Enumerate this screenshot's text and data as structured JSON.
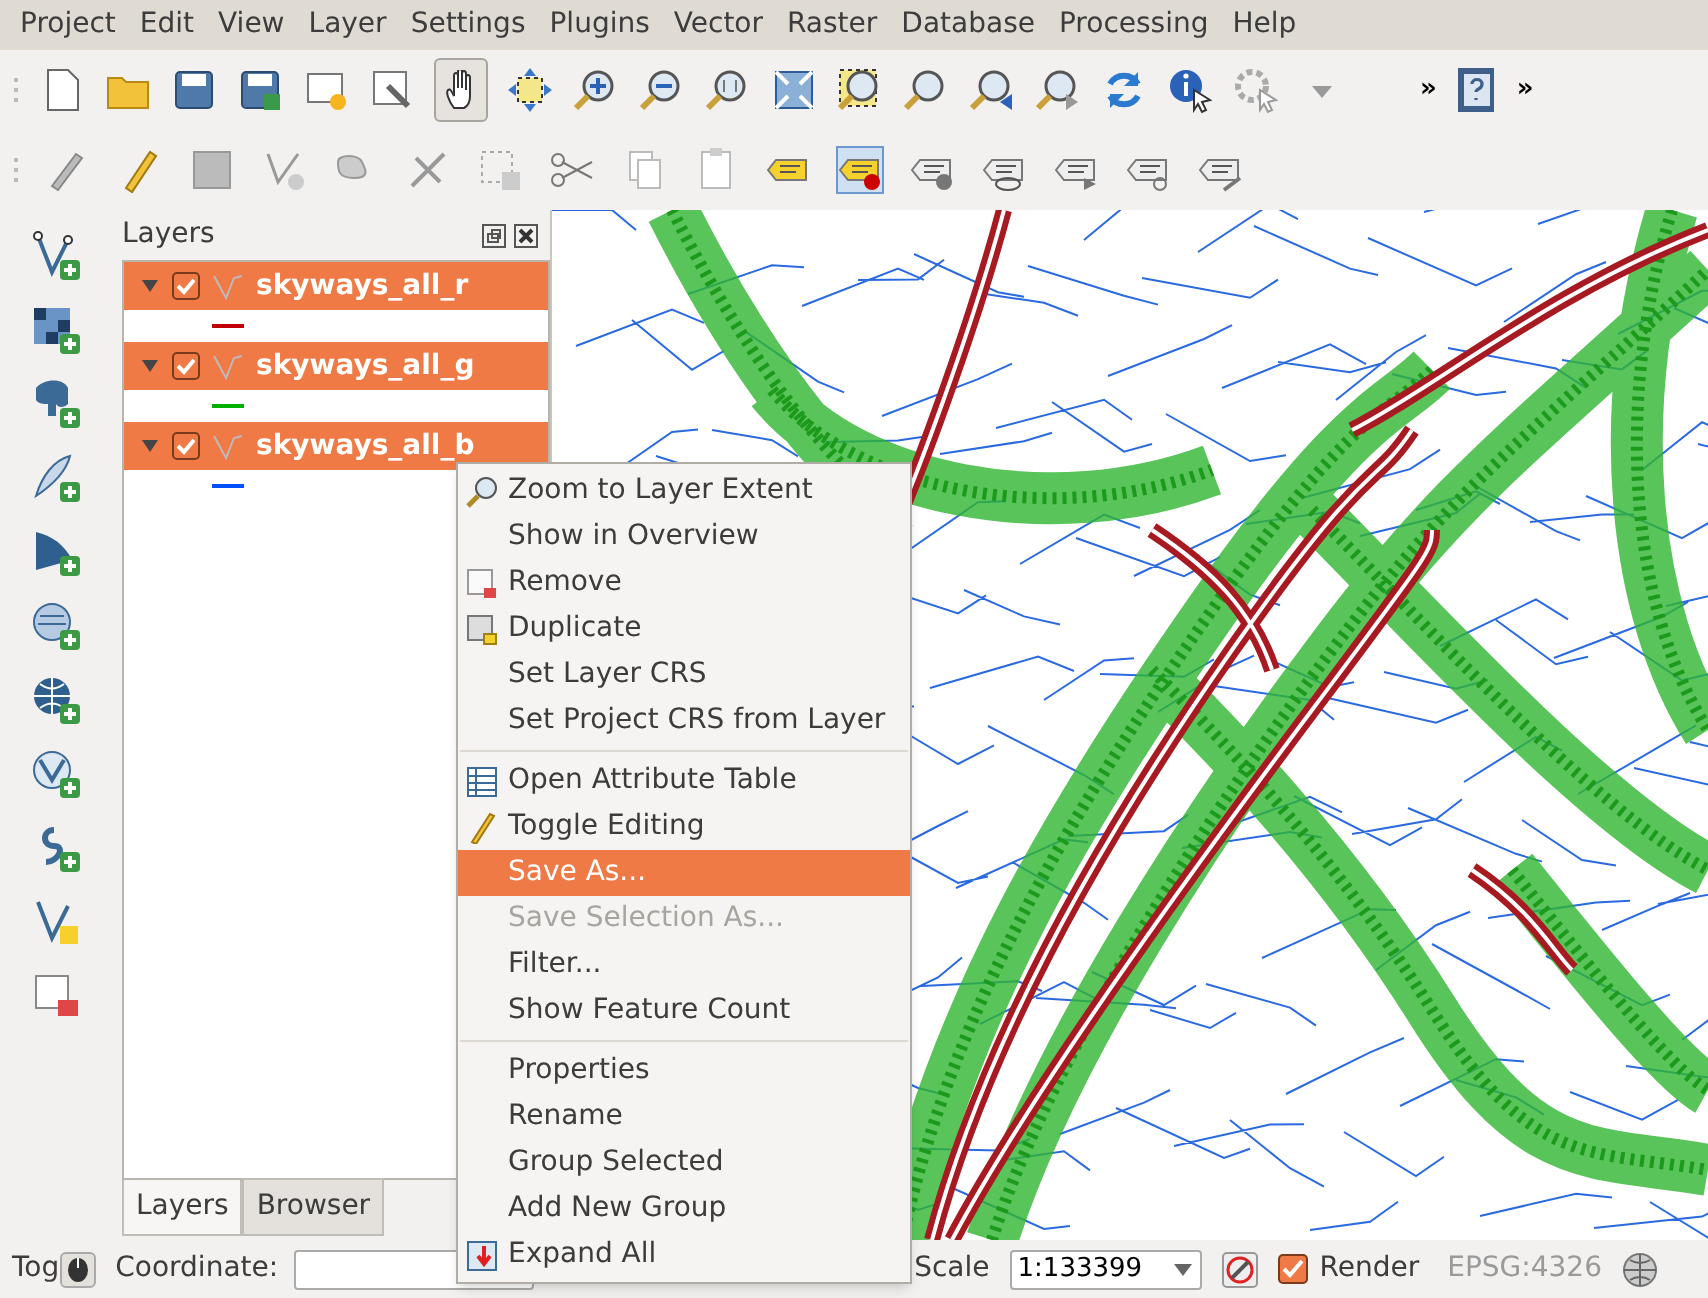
{
  "menu_bar": [
    "Project",
    "Edit",
    "View",
    "Layer",
    "Settings",
    "Plugins",
    "Vector",
    "Raster",
    "Database",
    "Processing",
    "Help"
  ],
  "toolbar_overflow": [
    "»",
    "»"
  ],
  "layers_panel": {
    "title": "Layers",
    "layers": [
      {
        "name": "skyways_all_r",
        "checked": true,
        "expanded": true,
        "selected": true,
        "color": "#c00000"
      },
      {
        "name": "skyways_all_g",
        "checked": true,
        "expanded": true,
        "selected": true,
        "color": "#00b000"
      },
      {
        "name": "skyways_all_b",
        "checked": true,
        "expanded": true,
        "selected": true,
        "color": "#0050ff"
      }
    ],
    "tabs": [
      {
        "label": "Layers",
        "selected": true
      },
      {
        "label": "Browser",
        "selected": false
      }
    ]
  },
  "context_menu": {
    "sections": [
      [
        {
          "label": "Zoom to Layer Extent",
          "kind": "zoom",
          "selected": false,
          "disabled": false
        },
        {
          "label": "Show in Overview",
          "kind": "plain",
          "selected": false,
          "disabled": false
        },
        {
          "label": "Remove",
          "kind": "remove",
          "selected": false,
          "disabled": false
        },
        {
          "label": "Duplicate",
          "kind": "duplicate",
          "selected": false,
          "disabled": false
        },
        {
          "label": "Set Layer CRS",
          "kind": "plain",
          "selected": false,
          "disabled": false
        },
        {
          "label": "Set Project CRS from Layer",
          "kind": "plain",
          "selected": false,
          "disabled": false
        }
      ],
      [
        {
          "label": "Open Attribute Table",
          "kind": "table",
          "selected": false,
          "disabled": false
        },
        {
          "label": "Toggle Editing",
          "kind": "pencil",
          "selected": false,
          "disabled": false
        },
        {
          "label": "Save As...",
          "kind": "plain",
          "selected": true,
          "disabled": false
        },
        {
          "label": "Save Selection As...",
          "kind": "plain",
          "selected": false,
          "disabled": true
        },
        {
          "label": "Filter...",
          "kind": "plain",
          "selected": false,
          "disabled": false
        },
        {
          "label": "Show Feature Count",
          "kind": "plain",
          "selected": false,
          "disabled": false
        }
      ],
      [
        {
          "label": "Properties",
          "kind": "plain",
          "selected": false,
          "disabled": false
        },
        {
          "label": "Rename",
          "kind": "plain",
          "selected": false,
          "disabled": false
        },
        {
          "label": "Group Selected",
          "kind": "plain",
          "selected": false,
          "disabled": false
        },
        {
          "label": "Add New Group",
          "kind": "plain",
          "selected": false,
          "disabled": false
        },
        {
          "label": "Expand All",
          "kind": "expand",
          "selected": false,
          "disabled": false
        }
      ]
    ]
  },
  "status_bar": {
    "toggle_label": "Tog",
    "coordinate_label": "Coordinate:",
    "scale_label": "Scale",
    "scale_value": "1:133399",
    "render": {
      "label": "Render",
      "checked": true
    },
    "crs": "EPSG:4326"
  }
}
